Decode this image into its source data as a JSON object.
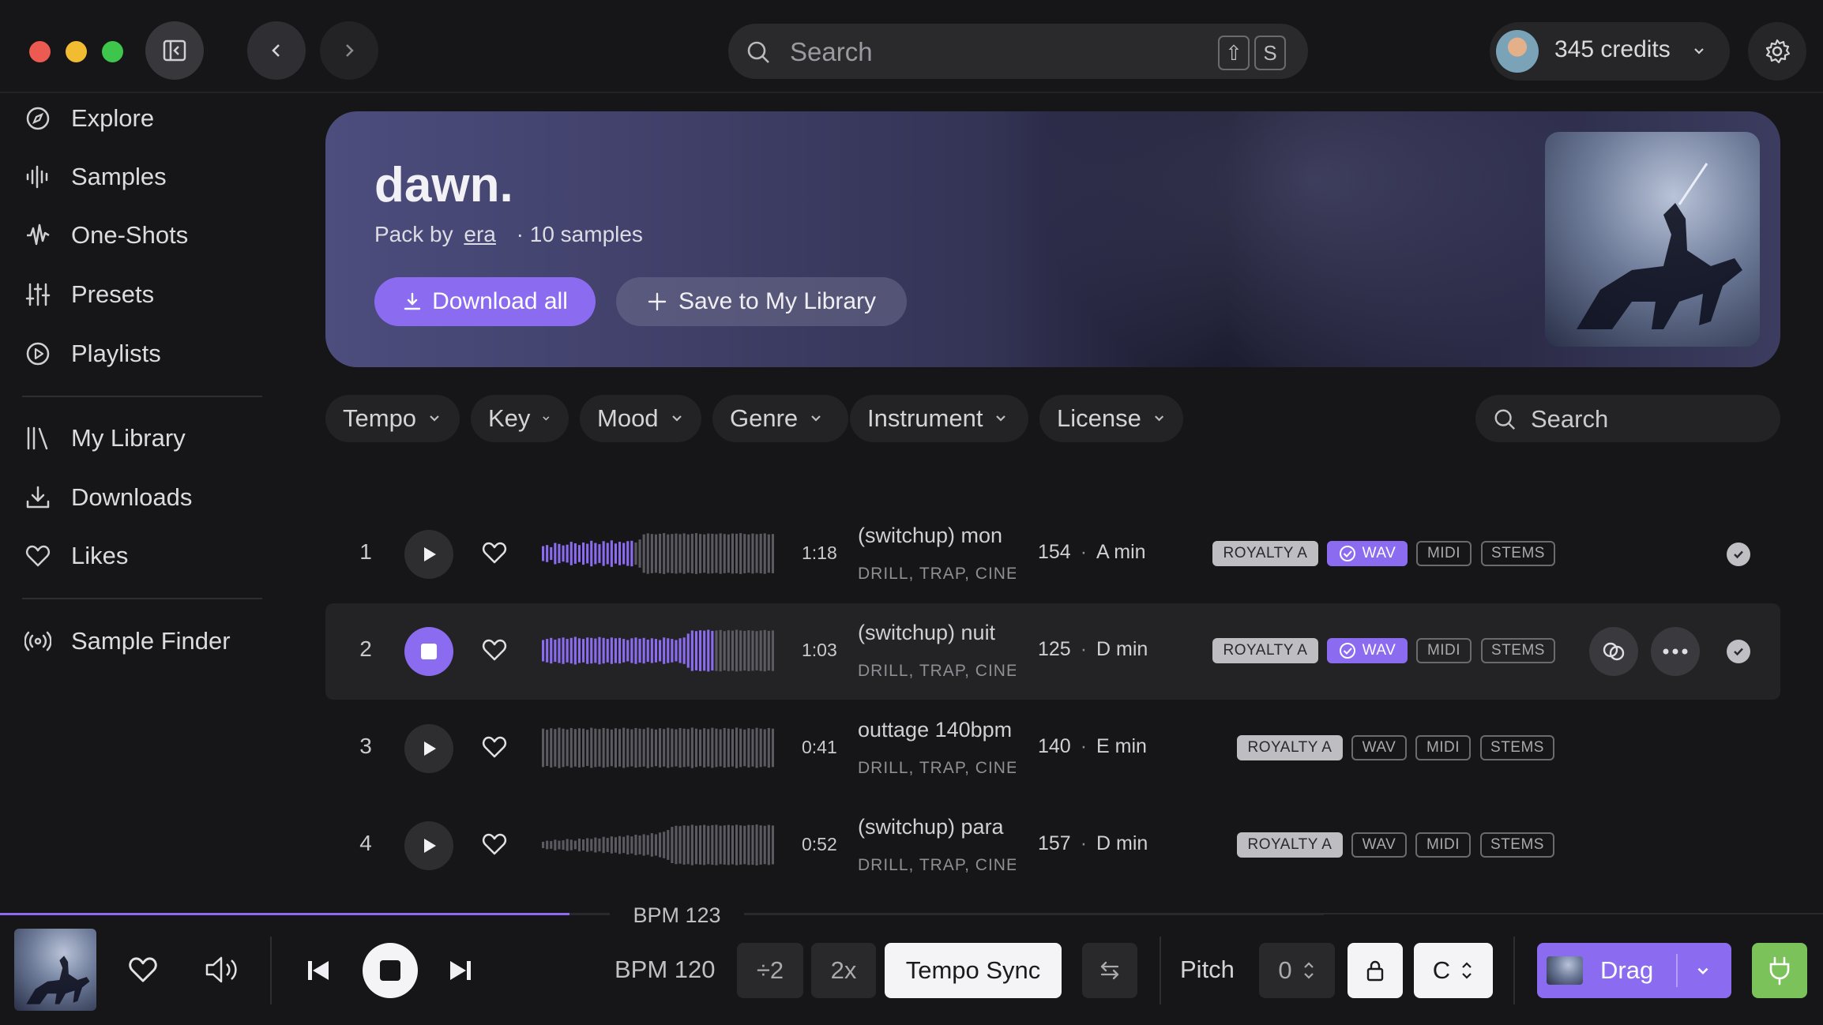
{
  "header": {
    "search_placeholder": "Search",
    "shortcut_key_1": "⇧",
    "shortcut_key_2": "S",
    "credits_label": "345 credits"
  },
  "sidebar": {
    "items": [
      {
        "label": "Explore",
        "icon": "compass-icon"
      },
      {
        "label": "Samples",
        "icon": "waveform-icon"
      },
      {
        "label": "One-Shots",
        "icon": "one-shot-icon"
      },
      {
        "label": "Presets",
        "icon": "sliders-icon"
      },
      {
        "label": "Playlists",
        "icon": "play-circle-icon"
      },
      {
        "label": "My Library",
        "icon": "library-icon"
      },
      {
        "label": "Downloads",
        "icon": "download-icon"
      },
      {
        "label": "Likes",
        "icon": "heart-icon"
      },
      {
        "label": "Sample Finder",
        "icon": "broadcast-icon"
      }
    ]
  },
  "hero": {
    "title": "dawn.",
    "byline_prefix": "Pack by",
    "author": "era",
    "sample_count": "· 10 samples",
    "download_all_label": "Download all",
    "save_label": "Save to My Library"
  },
  "filters": {
    "items": [
      "Tempo",
      "Key",
      "Mood",
      "Genre",
      "Instrument",
      "License"
    ],
    "search_placeholder": "Search"
  },
  "samples": [
    {
      "index": "1",
      "duration": "1:18",
      "title": "(switchup) mon",
      "tags": "DRILL, TRAP, CINE",
      "bpm": "154",
      "key": "A min",
      "license": "ROYALTY A",
      "formats": [
        "WAV",
        "MIDI",
        "STEMS"
      ],
      "playing": false,
      "progress": 0.38
    },
    {
      "index": "2",
      "duration": "1:03",
      "title": "(switchup) nuit",
      "tags": "DRILL, TRAP, CINE",
      "bpm": "125",
      "key": "D min",
      "license": "ROYALTY A",
      "formats": [
        "WAV",
        "MIDI",
        "STEMS"
      ],
      "playing": true,
      "progress": 0.73
    },
    {
      "index": "3",
      "duration": "0:41",
      "title": "outtage 140bpm",
      "tags": "DRILL, TRAP, CINE",
      "bpm": "140",
      "key": "E min",
      "license": "ROYALTY A",
      "formats": [
        "WAV",
        "MIDI",
        "STEMS"
      ],
      "playing": false,
      "progress": 0
    },
    {
      "index": "4",
      "duration": "0:52",
      "title": "(switchup) para",
      "tags": "DRILL, TRAP, CINE",
      "bpm": "157",
      "key": "D min",
      "license": "ROYALTY A",
      "formats": [
        "WAV",
        "MIDI",
        "STEMS"
      ],
      "playing": false,
      "progress": 0
    }
  ],
  "transport": {
    "bpm_readout": "BPM 123",
    "bpm_label": "BPM 120",
    "half_label": "÷2",
    "double_label": "2x",
    "tempo_sync_label": "Tempo Sync",
    "pitch_label": "Pitch",
    "pitch_value": "0",
    "key_value": "C",
    "drag_label": "Drag",
    "playback_progress": 0.43
  },
  "colors": {
    "accent": "#8b6cf1",
    "plugin_green": "#7bc25a",
    "background": "#161618"
  }
}
